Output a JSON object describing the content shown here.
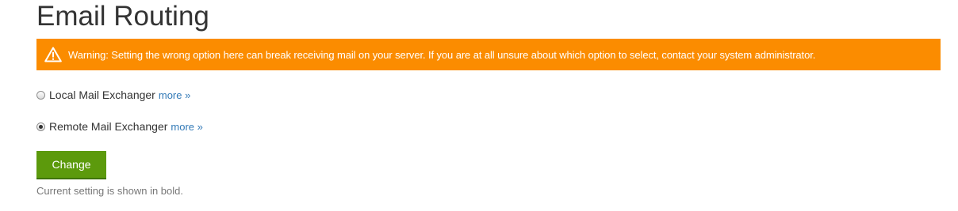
{
  "page": {
    "title": "Email Routing"
  },
  "warning": {
    "icon": "warning-triangle-icon",
    "text": "Warning: Setting the wrong option here can break receiving mail on your server. If you are at all unsure about which option to select, contact your system administrator.",
    "background": "#fb8c00"
  },
  "options": [
    {
      "label": "Local Mail Exchanger",
      "more": "more »",
      "checked": false
    },
    {
      "label": "Remote Mail Exchanger",
      "more": "more »",
      "checked": true
    }
  ],
  "actions": {
    "change_label": "Change",
    "button_color": "#5c9a0c"
  },
  "help": {
    "text": "Current setting is shown in bold."
  }
}
